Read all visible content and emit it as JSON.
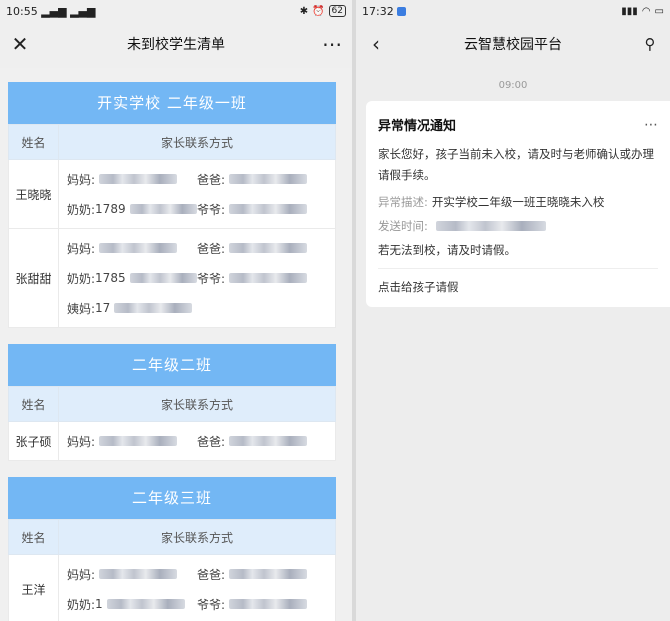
{
  "left": {
    "status_time": "10:55",
    "status_signal": "▂▄▆ ▂▄▆",
    "battery": "62",
    "nav_title": "未到校学生清单",
    "classes": [
      {
        "title": "开实学校  二年级一班",
        "header_name": "姓名",
        "header_contact": "家长联系方式",
        "students": [
          {
            "name": "王晓晓",
            "rows": [
              [
                {
                  "label": "妈妈:",
                  "value": ""
                },
                {
                  "label": "爸爸:",
                  "value": ""
                }
              ],
              [
                {
                  "label": "奶奶:",
                  "value": "1789"
                },
                {
                  "label": "爷爷:",
                  "value": ""
                }
              ]
            ]
          },
          {
            "name": "张甜甜",
            "rows": [
              [
                {
                  "label": "妈妈:",
                  "value": ""
                },
                {
                  "label": "爸爸:",
                  "value": ""
                }
              ],
              [
                {
                  "label": "奶奶:",
                  "value": "1785"
                },
                {
                  "label": "爷爷:",
                  "value": ""
                }
              ],
              [
                {
                  "label": "姨妈:",
                  "value": "17"
                }
              ]
            ]
          }
        ]
      },
      {
        "title": "二年级二班",
        "header_name": "姓名",
        "header_contact": "家长联系方式",
        "students": [
          {
            "name": "张子硕",
            "rows": [
              [
                {
                  "label": "妈妈:",
                  "value": ""
                },
                {
                  "label": "爸爸:",
                  "value": ""
                }
              ]
            ]
          }
        ]
      },
      {
        "title": "二年级三班",
        "header_name": "姓名",
        "header_contact": "家长联系方式",
        "students": [
          {
            "name": "王洋",
            "rows": [
              [
                {
                  "label": "妈妈:",
                  "value": ""
                },
                {
                  "label": "爸爸:",
                  "value": ""
                }
              ],
              [
                {
                  "label": "奶奶:",
                  "value": "1"
                },
                {
                  "label": "爷爷:",
                  "value": ""
                }
              ]
            ]
          }
        ]
      }
    ]
  },
  "right": {
    "status_time": "17:32",
    "nav_title": "云智慧校园平台",
    "msg_time": "09:00",
    "card_title": "异常情况通知",
    "body": "家长您好，孩子当前未入校，请及时与老师确认或办理请假手续。",
    "desc_label": "异常描述:",
    "desc_value": "开实学校二年级一班王晓晓未入校",
    "send_label": "发送时间:",
    "note": "若无法到校，请及时请假。",
    "link": "点击给孩子请假"
  }
}
